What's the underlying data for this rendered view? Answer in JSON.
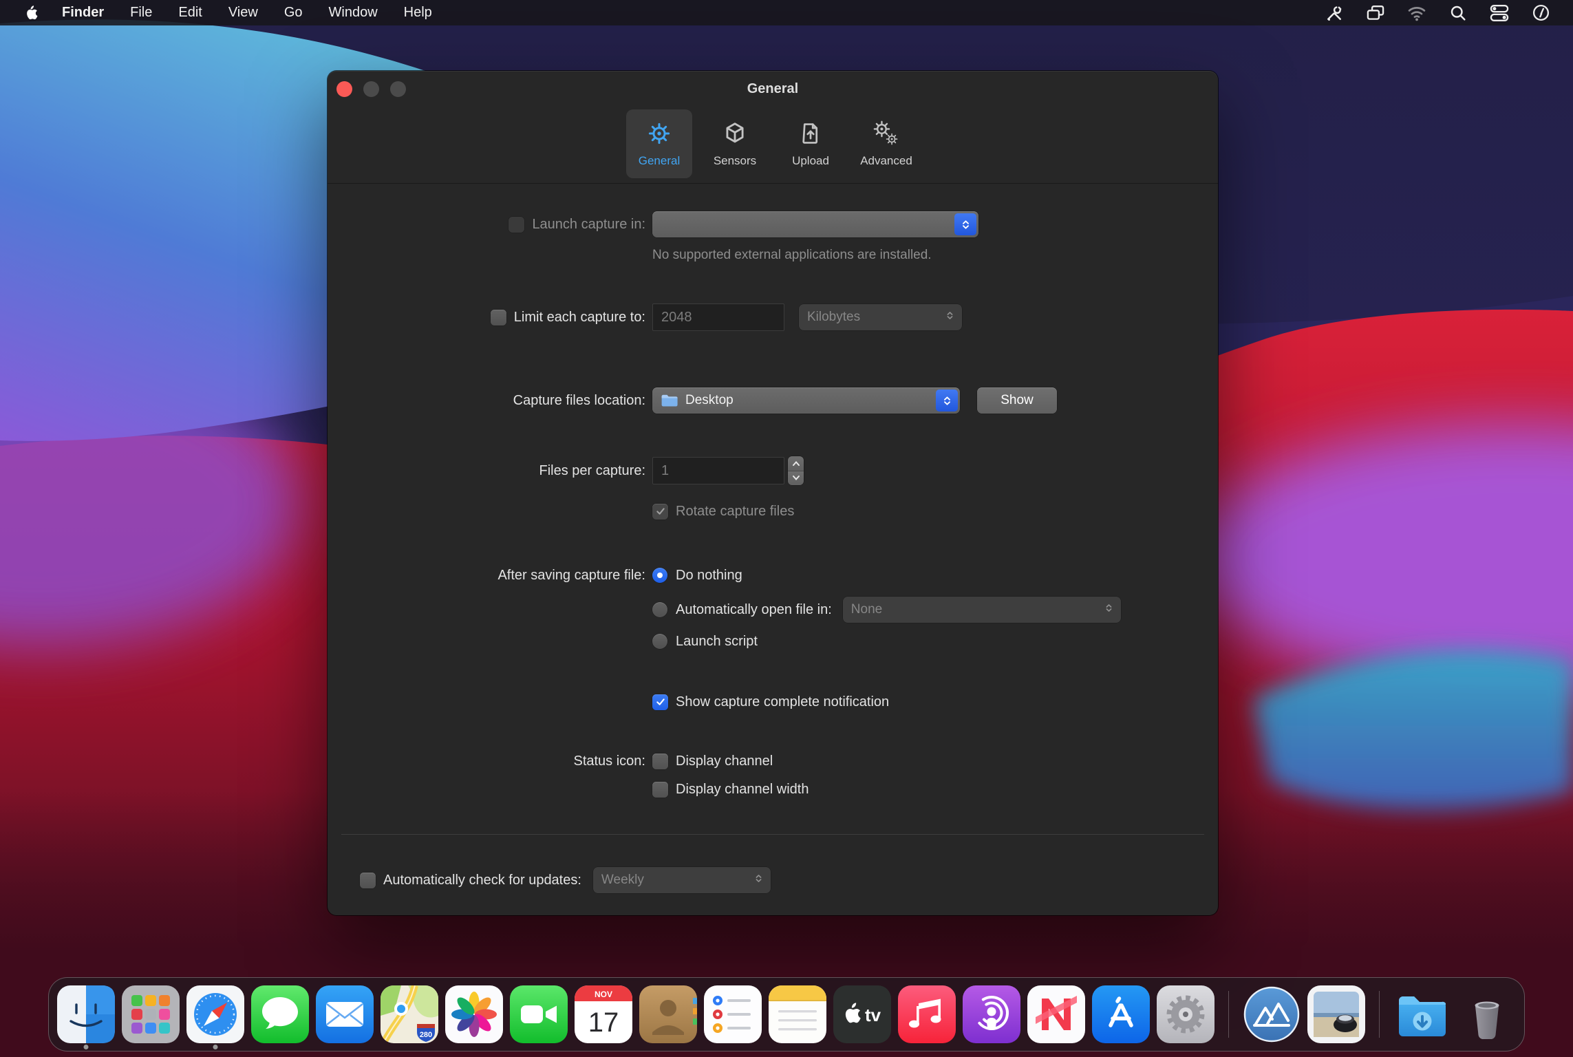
{
  "accent_colors": {
    "selection_blue": "#2a6bea",
    "tab_highlight_blue": "#41a5f2",
    "traffic_close_red": "#fb5a56"
  },
  "menubar": {
    "apple_logo_icon": "apple-icon",
    "items": [
      "Finder",
      "File",
      "Edit",
      "View",
      "Go",
      "Window",
      "Help"
    ],
    "status_icons": [
      "tools-icon",
      "display-mirroring-icon",
      "wifi-icon",
      "search-icon",
      "control-center-icon",
      "clock-icon"
    ]
  },
  "window": {
    "title": "General",
    "tabs": [
      {
        "label": "General",
        "icon": "gear-icon",
        "selected": true
      },
      {
        "label": "Sensors",
        "icon": "cube-icon",
        "selected": false
      },
      {
        "label": "Upload",
        "icon": "upload-document-icon",
        "selected": false
      },
      {
        "label": "Advanced",
        "icon": "double-gear-icon",
        "selected": false
      }
    ],
    "rows": {
      "launch": {
        "label": "Launch capture in:",
        "checkbox_checked": false,
        "enabled": false,
        "popup_value": "",
        "note": "No supported external applications are installed."
      },
      "limit": {
        "label": "Limit each capture to:",
        "checkbox_checked": false,
        "field_value": "2048",
        "unit_popup_value": "Kilobytes",
        "field_enabled": false
      },
      "location": {
        "label": "Capture files location:",
        "popup_value": "Desktop",
        "popup_icon": "folder-icon",
        "button_label": "Show"
      },
      "files": {
        "label": "Files per capture:",
        "field_value": "1",
        "field_enabled": false
      },
      "rotate": {
        "label": "Rotate capture files",
        "checked": true,
        "enabled": false
      },
      "after": {
        "label": "After saving capture file:",
        "options": [
          {
            "label": "Do nothing",
            "selected": true
          },
          {
            "label": "Automatically open file in:",
            "selected": false,
            "popup_value": "None",
            "popup_enabled": false
          },
          {
            "label": "Launch script",
            "selected": false
          }
        ]
      },
      "notification": {
        "label": "Show capture complete notification",
        "checked": true
      },
      "status": {
        "label": "Status icon:",
        "options": [
          {
            "label": "Display channel",
            "checked": false
          },
          {
            "label": "Display channel width",
            "checked": false
          }
        ]
      },
      "updates": {
        "label": "Automatically check for updates:",
        "checked": false,
        "popup_value": "Weekly",
        "popup_enabled": false
      }
    }
  },
  "dock": {
    "items": [
      {
        "icon": "finder-icon",
        "running": true
      },
      {
        "icon": "launchpad-icon",
        "running": false
      },
      {
        "icon": "safari-icon",
        "running": true
      },
      {
        "icon": "messages-icon",
        "running": false
      },
      {
        "icon": "mail-icon",
        "running": false
      },
      {
        "icon": "maps-icon",
        "running": false
      },
      {
        "icon": "photos-icon",
        "running": false
      },
      {
        "icon": "facetime-icon",
        "running": false
      },
      {
        "icon": "calendar-icon",
        "running": false
      },
      {
        "icon": "contacts-icon",
        "running": false
      },
      {
        "icon": "reminders-icon",
        "running": false
      },
      {
        "icon": "notes-icon",
        "running": false
      },
      {
        "icon": "apple-tv-icon",
        "running": false
      },
      {
        "icon": "music-icon",
        "running": false
      },
      {
        "icon": "podcasts-icon",
        "running": false
      },
      {
        "icon": "news-icon",
        "running": false
      },
      {
        "icon": "app-store-icon",
        "running": false
      },
      {
        "icon": "system-preferences-icon",
        "running": false
      },
      {
        "icon": "capture-app-icon",
        "running": false
      },
      {
        "icon": "viewer-app-icon",
        "running": false
      },
      {
        "icon": "downloads-folder-icon",
        "running": false
      },
      {
        "icon": "trash-icon",
        "running": false
      }
    ],
    "calendar": {
      "month": "NOV",
      "day": "17"
    },
    "appletv_label": "tv",
    "maps_shield": "280"
  }
}
